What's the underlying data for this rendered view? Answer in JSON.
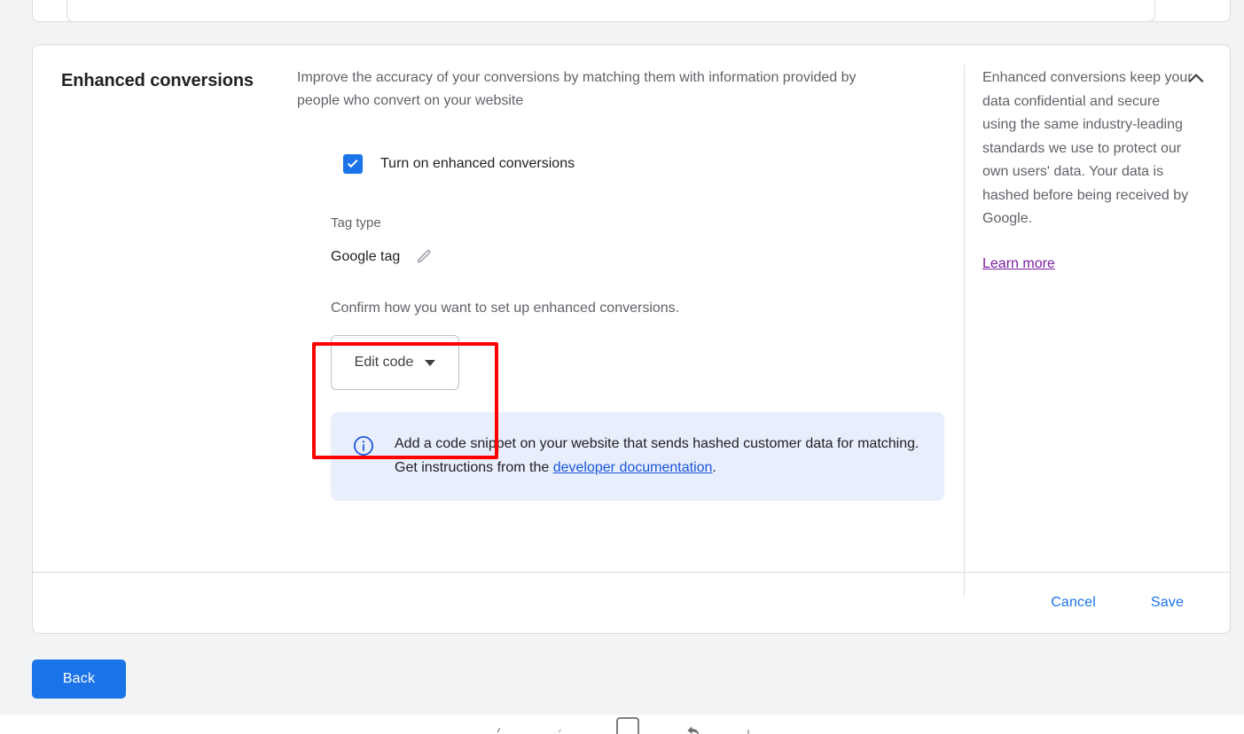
{
  "section": {
    "title": "Enhanced conversions",
    "lead": "Improve the accuracy of your conversions by matching them with information provided by people who convert on your website",
    "checkbox_label": "Turn on enhanced conversions",
    "checkbox_checked": true,
    "tag_type_label": "Tag type",
    "tag_type_value": "Google tag",
    "edit_pencil_icon": "pencil-icon",
    "confirm_text": "Confirm how you want to set up enhanced conversions.",
    "edit_code_button": "Edit code",
    "dropdown_icon": "caret-down-icon"
  },
  "info_banner": {
    "icon": "info-circle-icon",
    "text_before": "Add a code snippet on your website that sends hashed customer data for matching. Get instructions from the ",
    "link_text": "developer documentation",
    "text_after": "."
  },
  "side_panel": {
    "text": "Enhanced conversions keep your data confidential and secure using the same industry-leading standards we use to protect our own users' data. Your data is hashed before being received by Google.",
    "link": "Learn more",
    "collapse_icon": "chevron-up-icon"
  },
  "footer": {
    "cancel": "Cancel",
    "save": "Save"
  },
  "nav": {
    "back": "Back"
  },
  "annotation": {
    "type": "highlight-rectangle",
    "color": "#fe0000",
    "targets": "edit-code-button"
  },
  "colors": {
    "accent_blue": "#1a73e8",
    "link_blue": "#1a56db",
    "visited_purple": "#7b1fa2",
    "page_background": "#f1f3f4",
    "card_background": "#ffffff",
    "border_gray": "#dadce0",
    "text_primary": "#202124",
    "text_secondary": "#5f6368",
    "banner_background": "#e8eefc",
    "annotation_red": "#fe0000"
  }
}
